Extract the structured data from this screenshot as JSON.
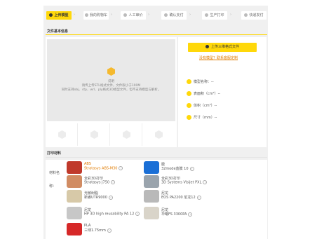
{
  "steps": [
    {
      "label": "上传模型",
      "active": true
    },
    {
      "label": "我的购物车",
      "active": false
    },
    {
      "label": "人工审价",
      "active": false
    },
    {
      "label": "确认支付",
      "active": false
    },
    {
      "label": "生产打印",
      "active": false
    },
    {
      "label": "快递发付",
      "active": false
    }
  ],
  "file_section": {
    "title": "文件基本信息",
    "drop_title": "说明",
    "drop_line1": "请传上传STL格式文件，文件限小于100M",
    "drop_line2": "同时支持obj、stp、wrl、ply格式3D模型文件，但不支持模型与解析。"
  },
  "upload": {
    "button_label": "上传三维格式文件",
    "help_link": "没有模型？联系客服定制"
  },
  "model_info": [
    {
      "label": "模型名称：",
      "value": "--"
    },
    {
      "label": "表面积（cm²）",
      "value": "--"
    },
    {
      "label": "体积（cm³）",
      "value": "--"
    },
    {
      "label": "尺寸（mm）",
      "value": "--"
    }
  ],
  "print_section": {
    "title": "打印材料",
    "material_label": "材料名",
    "process_label": "称："
  },
  "materials": [
    {
      "name": "ABS",
      "desc": "Stratasys ABS-M30",
      "highlight": true,
      "color": "#c0392b"
    },
    {
      "name": "膜",
      "desc": "32mode蓝膜 10",
      "highlight": false,
      "color": "#1a6fd6"
    },
    {
      "name": "全彩3D打印",
      "desc": "Stratasys J750",
      "highlight": false,
      "color": "#d18c63"
    },
    {
      "name": "全彩3D打印",
      "desc": "3D Systems Visijet PXL",
      "highlight": false,
      "color": "#9aa4ad"
    },
    {
      "name": "光敏树脂",
      "desc": "新睿UTR9000",
      "highlight": false,
      "color": "#d7c9a8"
    },
    {
      "name": "尼龙",
      "desc": "EOS PA2200 尼龙12",
      "highlight": false,
      "color": "#b9b9b9"
    },
    {
      "name": "尼龙",
      "desc": "HP 3D high reusability PA 12",
      "highlight": false,
      "color": "#c7c7c7"
    },
    {
      "name": "尼龙",
      "desc": "华曙FS 3300PA",
      "highlight": false,
      "color": "#d9d4c9"
    },
    {
      "name": "PLA",
      "desc": "三绿1.75mm",
      "highlight": false,
      "color": "#d62828"
    }
  ]
}
